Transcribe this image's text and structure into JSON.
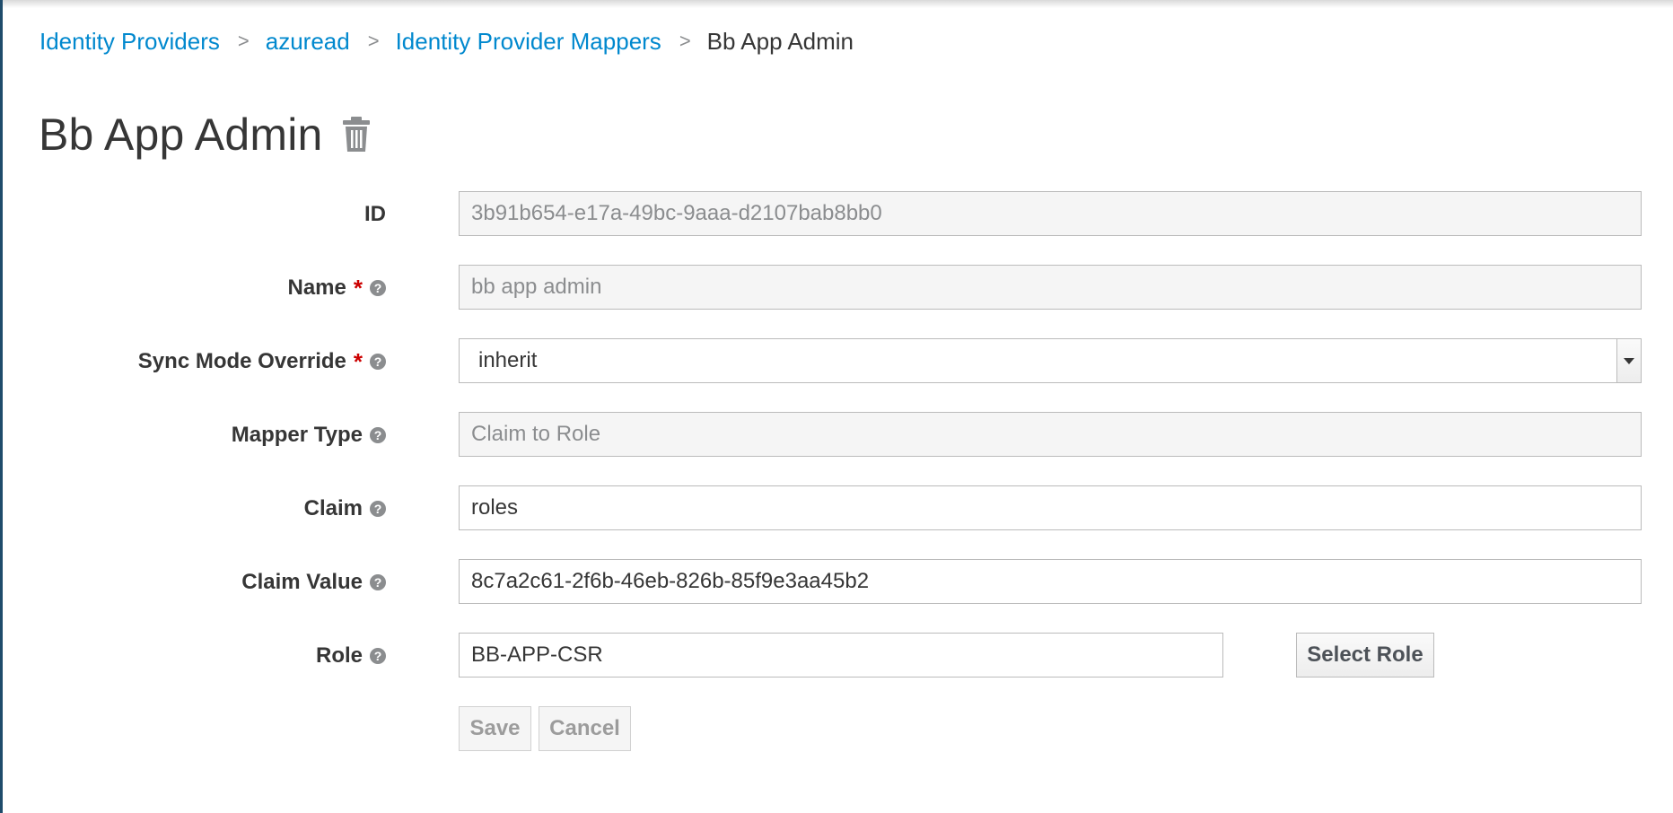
{
  "breadcrumb": {
    "items": [
      "Identity Providers",
      "azuread",
      "Identity Provider Mappers"
    ],
    "current": "Bb App Admin",
    "separator": ">"
  },
  "page": {
    "title": "Bb App Admin"
  },
  "form": {
    "id": {
      "label": "ID",
      "value": "3b91b654-e17a-49bc-9aaa-d2107bab8bb0"
    },
    "name": {
      "label": "Name",
      "required": "*",
      "value": "bb app admin"
    },
    "sync_mode": {
      "label": "Sync Mode Override",
      "required": "*",
      "value": "inherit"
    },
    "mapper_type": {
      "label": "Mapper Type",
      "value": "Claim to Role"
    },
    "claim": {
      "label": "Claim",
      "value": "roles"
    },
    "claim_value": {
      "label": "Claim Value",
      "value": "8c7a2c61-2f6b-46eb-826b-85f9e3aa45b2"
    },
    "role": {
      "label": "Role",
      "value": "BB-APP-CSR",
      "select_label": "Select Role"
    },
    "help_glyph": "?"
  },
  "actions": {
    "save": "Save",
    "cancel": "Cancel"
  },
  "colors": {
    "link": "#0088ce",
    "required": "#cc0000",
    "readonly_bg": "#f5f5f5"
  }
}
